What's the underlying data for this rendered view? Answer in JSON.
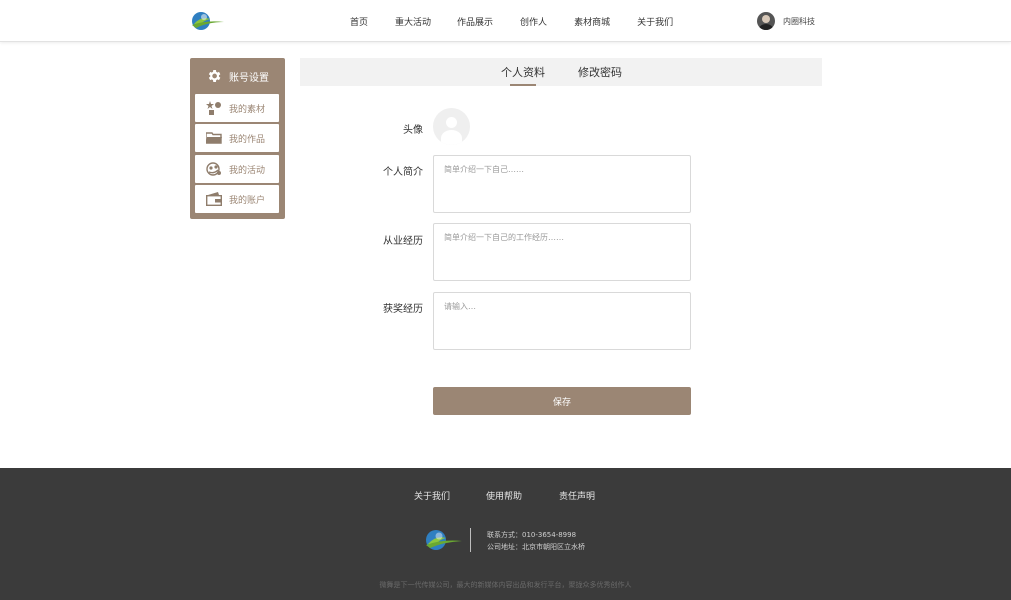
{
  "header": {
    "nav": [
      "首页",
      "重大活动",
      "作品展示",
      "创作人",
      "素材商城",
      "关于我们"
    ],
    "user_name": "内圈科技"
  },
  "sidebar": {
    "title": "账号设置",
    "items": [
      {
        "label": "我的素材",
        "icon": "assets-icon"
      },
      {
        "label": "我的作品",
        "icon": "folder-icon"
      },
      {
        "label": "我的活动",
        "icon": "activity-icon"
      },
      {
        "label": "我的账户",
        "icon": "wallet-icon"
      }
    ]
  },
  "tabs": {
    "profile": "个人资料",
    "password": "修改密码",
    "active": "profile"
  },
  "form": {
    "avatar_label": "头像",
    "bio_label": "个人简介",
    "bio_placeholder": "简单介绍一下自己……",
    "bio_value": "",
    "experience_label": "从业经历",
    "experience_placeholder": "简单介绍一下自己的工作经历……",
    "experience_value": "",
    "awards_label": "获奖经历",
    "awards_placeholder": "请输入…",
    "awards_value": "",
    "save_label": "保存"
  },
  "footer": {
    "links": [
      "关于我们",
      "使用帮助",
      "责任声明"
    ],
    "contact": "联系方式：010-3654-8998",
    "address": "公司地址：北京市朝阳区立水桥",
    "slogan": "微舞是下一代传媒公司，最大的新媒体内容出品和发行平台，聚拢众多优秀创作人"
  },
  "colors": {
    "accent": "#9b8674",
    "footer_bg": "#3b3b3b",
    "tab_bg": "#f2f2f2"
  }
}
